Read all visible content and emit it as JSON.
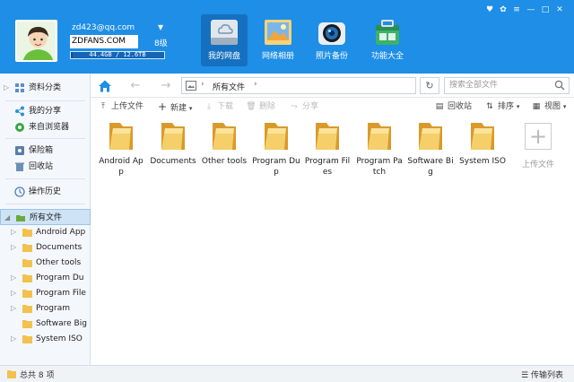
{
  "header": {
    "user_email": "zd423@qq.com",
    "user_name": "ZDFANS.COM",
    "user_level": "8级",
    "quota_text": "44.4GB / 12.6TB",
    "quota_used_fraction": 0.0034,
    "dropdown_glyph": "▼",
    "tabs": [
      {
        "label": "我的网盘",
        "icon": "cloud-disk-icon",
        "active": true
      },
      {
        "label": "网络相册",
        "icon": "photo-album-icon",
        "active": false
      },
      {
        "label": "照片备份",
        "icon": "camera-icon",
        "active": false
      },
      {
        "label": "功能大全",
        "icon": "toolbox-icon",
        "active": false
      }
    ],
    "window_controls": {
      "pin": "♥",
      "skin": "✿",
      "menu": "≡",
      "minimize": "—",
      "maximize": "□",
      "close": "✕"
    }
  },
  "sidebar": {
    "items": [
      {
        "label": "资料分类",
        "icon": "category-icon"
      },
      {
        "label": "我的分享",
        "icon": "share-icon"
      },
      {
        "label": "来自浏览器",
        "icon": "browser-icon"
      },
      {
        "label": "保险箱",
        "icon": "safe-icon"
      },
      {
        "label": "回收站",
        "icon": "recycle-bin-icon"
      },
      {
        "label": "操作历史",
        "icon": "history-icon"
      },
      {
        "label": "所有文件",
        "icon": "all-files-icon"
      }
    ],
    "tree": [
      "Android App",
      "Documents",
      "Other tools",
      "Program Du",
      "Program File",
      "Program",
      "Software Big",
      "System ISO"
    ]
  },
  "address": {
    "path": "所有文件",
    "search_placeholder": "搜索全部文件"
  },
  "toolbar": {
    "upload": "上传文件",
    "new": "新建",
    "download": "下载",
    "delete": "删除",
    "share": "分享",
    "trash": "回收站",
    "sort": "排序",
    "view": "视图"
  },
  "files": [
    {
      "name": "Android App"
    },
    {
      "name": "Documents"
    },
    {
      "name": "Other tools"
    },
    {
      "name": "Program Dup"
    },
    {
      "name": "Program Files"
    },
    {
      "name": "Program Patch"
    },
    {
      "name": "Software Big"
    },
    {
      "name": "System ISO"
    }
  ],
  "upload_tile_label": "上传文件",
  "status": {
    "total": "总共 8 项",
    "transfer": "传输列表"
  },
  "colors": {
    "brand": "#1e8ee6",
    "folder": "#f2c14e"
  }
}
